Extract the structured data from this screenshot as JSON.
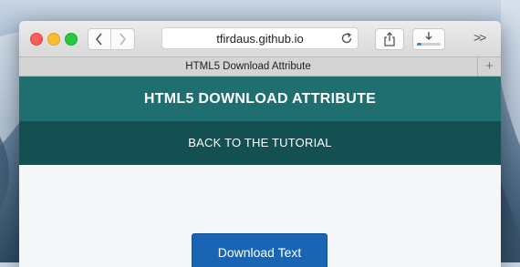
{
  "browser": {
    "url": "tfirdaus.github.io",
    "tab_title": "HTML5 Download Attribute",
    "new_tab_symbol": "+",
    "overflow_symbol": ">>",
    "download_progress": 0.2
  },
  "page": {
    "header_title": "HTML5 DOWNLOAD ATTRIBUTE",
    "subnav_link": "BACK TO THE TUTORIAL",
    "download_button": "Download Text"
  },
  "colors": {
    "header_bg": "#1f6e70",
    "subnav_bg": "#145052",
    "button_bg": "#1a64b4"
  },
  "icons": [
    "back-arrow-icon",
    "forward-arrow-icon",
    "reload-icon",
    "share-icon",
    "download-icon",
    "close-icon",
    "minimize-icon",
    "zoom-icon"
  ]
}
